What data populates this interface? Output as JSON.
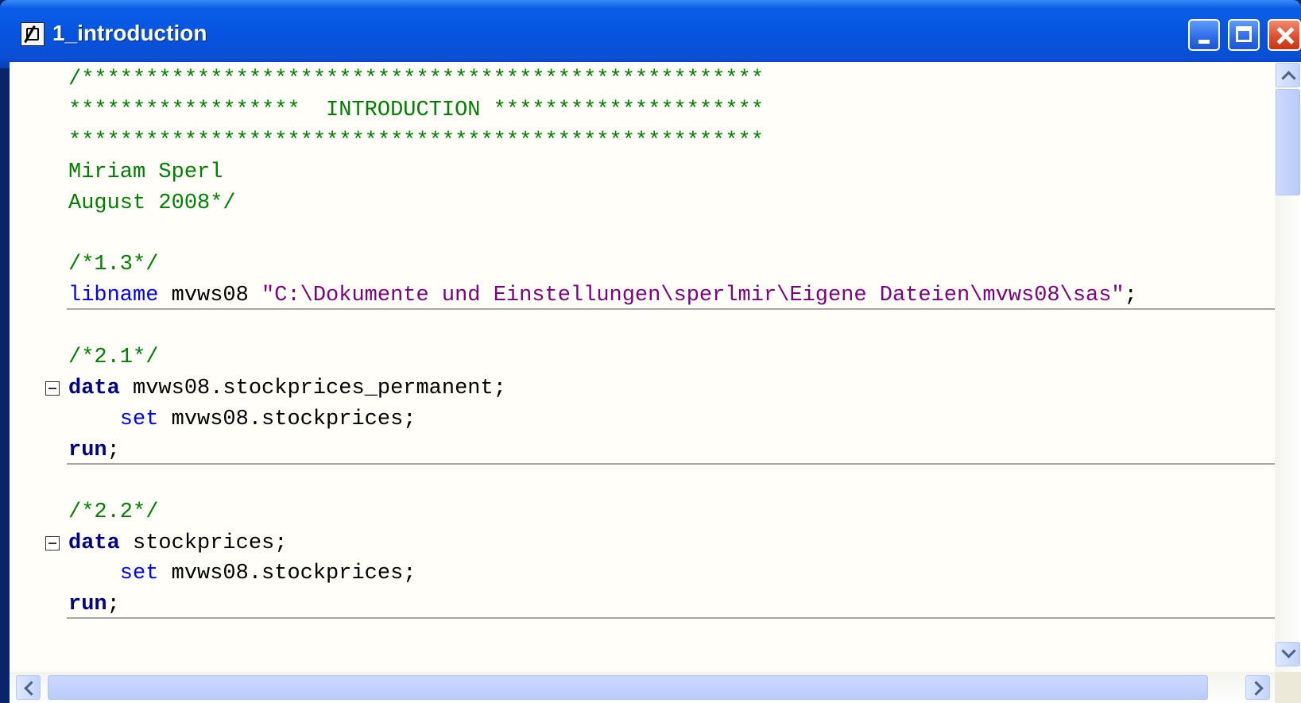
{
  "window": {
    "title": "1_introduction",
    "buttons": {
      "minimize": "minimize",
      "maximize": "maximize",
      "close": "close"
    }
  },
  "editor": {
    "lines": [
      {
        "segments": [
          {
            "text": "/*****************************************************",
            "style": "comment"
          }
        ]
      },
      {
        "segments": [
          {
            "text": "******************  INTRODUCTION *********************",
            "style": "comment"
          }
        ]
      },
      {
        "segments": [
          {
            "text": "******************************************************",
            "style": "comment"
          }
        ]
      },
      {
        "segments": [
          {
            "text": "Miriam Sperl",
            "style": "comment"
          }
        ]
      },
      {
        "segments": [
          {
            "text": "August 2008*/",
            "style": "comment"
          }
        ]
      },
      {
        "segments": []
      },
      {
        "segments": [
          {
            "text": "/*1.3*/",
            "style": "comment"
          }
        ]
      },
      {
        "segments": [
          {
            "text": "libname",
            "style": "statement"
          },
          {
            "text": " mvws08 ",
            "style": "plain"
          },
          {
            "text": "\"C:\\Dokumente und Einstellungen\\sperlmir\\Eigene Dateien\\mvws08\\sas\"",
            "style": "string"
          },
          {
            "text": ";",
            "style": "plain"
          }
        ]
      },
      {
        "segments": []
      },
      {
        "segments": [
          {
            "text": "/*2.1*/",
            "style": "comment"
          }
        ]
      },
      {
        "segments": [
          {
            "text": "data",
            "style": "keyword"
          },
          {
            "text": " mvws08.stockprices_permanent;",
            "style": "plain"
          }
        ],
        "fold": true
      },
      {
        "segments": [
          {
            "text": "    set",
            "style": "statement"
          },
          {
            "text": " mvws08.stockprices;",
            "style": "plain"
          }
        ]
      },
      {
        "segments": [
          {
            "text": "run",
            "style": "keyword"
          },
          {
            "text": ";",
            "style": "plain"
          }
        ]
      },
      {
        "segments": []
      },
      {
        "segments": [
          {
            "text": "/*2.2*/",
            "style": "comment"
          }
        ]
      },
      {
        "segments": [
          {
            "text": "data",
            "style": "keyword"
          },
          {
            "text": " stockprices;",
            "style": "plain"
          }
        ],
        "fold": true
      },
      {
        "segments": [
          {
            "text": "    set",
            "style": "statement"
          },
          {
            "text": " mvws08.stockprices;",
            "style": "plain"
          }
        ]
      },
      {
        "segments": [
          {
            "text": "run",
            "style": "keyword"
          },
          {
            "text": ";",
            "style": "plain"
          }
        ]
      }
    ],
    "separators_after_lines": [
      7,
      12,
      17
    ]
  },
  "colors": {
    "comment": "#008000",
    "keyword": "#00008b",
    "statement": "#0000ff",
    "string": "#800080",
    "plain": "#000000",
    "titlebar": "#0654e0"
  },
  "icons": {
    "app": "sas-program-icon",
    "minimize": "minimize-icon",
    "maximize": "maximize-icon",
    "close": "close-icon"
  }
}
